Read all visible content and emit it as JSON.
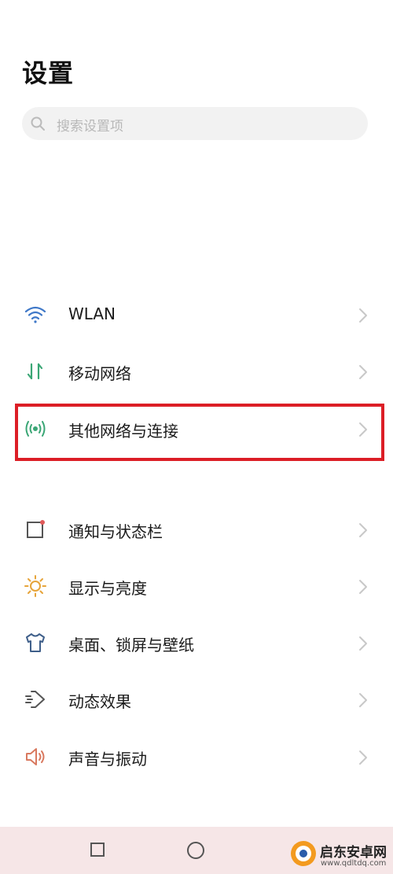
{
  "header": {
    "title": "设置"
  },
  "search": {
    "placeholder": "搜索设置项"
  },
  "groups": [
    {
      "items": [
        {
          "label": "WLAN",
          "icon": "wifi-icon",
          "color": "#3f78c8"
        },
        {
          "label": "移动网络",
          "icon": "mobile-data-icon",
          "color": "#3aa675"
        },
        {
          "label": "其他网络与连接",
          "icon": "connection-icon",
          "color": "#3aa675",
          "highlighted": true
        }
      ]
    },
    {
      "items": [
        {
          "label": "通知与状态栏",
          "icon": "notification-icon",
          "color": "#555555"
        },
        {
          "label": "显示与亮度",
          "icon": "brightness-icon",
          "color": "#e6a43a"
        },
        {
          "label": "桌面、锁屏与壁纸",
          "icon": "wallpaper-icon",
          "color": "#3f5f8a"
        },
        {
          "label": "动态效果",
          "icon": "animation-icon",
          "color": "#555555"
        },
        {
          "label": "声音与振动",
          "icon": "sound-icon",
          "color": "#d9795f"
        }
      ]
    }
  ],
  "watermark": {
    "title": "启东安卓网",
    "url": "www.qdltdq.com"
  },
  "colors": {
    "highlight": "#dc1e26",
    "navbar": "#f6e6e7",
    "chevron": "#c8c8c8"
  }
}
